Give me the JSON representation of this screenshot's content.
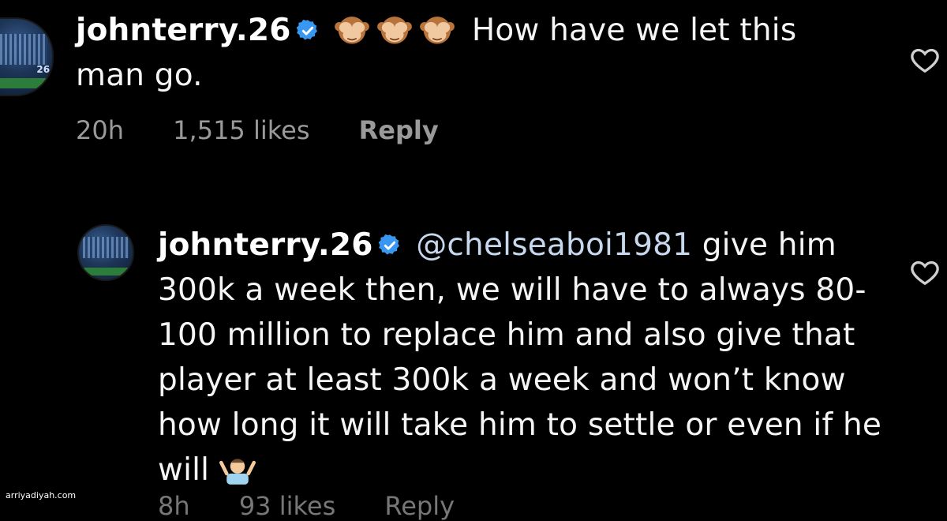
{
  "comments": [
    {
      "username": "johnterry.26",
      "verified": true,
      "emoji": "see-no-evil-monkey",
      "emoji_count": 3,
      "text": "How have we let this man go.",
      "time": "20h",
      "likes": "1,515 likes",
      "reply_label": "Reply"
    },
    {
      "username": "johnterry.26",
      "verified": true,
      "mention": "@chelseaboi1981",
      "text": "give him 300k a week then, we will have to always 80-100 million to replace him and also give that player at least 300k a week and won’t know how long it will take him to settle or even if he will",
      "emoji": "man-shrugging",
      "time": "8h",
      "likes": "93 likes",
      "reply_label": "Reply"
    }
  ],
  "watermark": "arriyadiyah.com",
  "colors": {
    "background": "#000000",
    "text": "#f5f5f5",
    "meta": "#9a9a9a",
    "verified_blue": "#3897f0"
  }
}
